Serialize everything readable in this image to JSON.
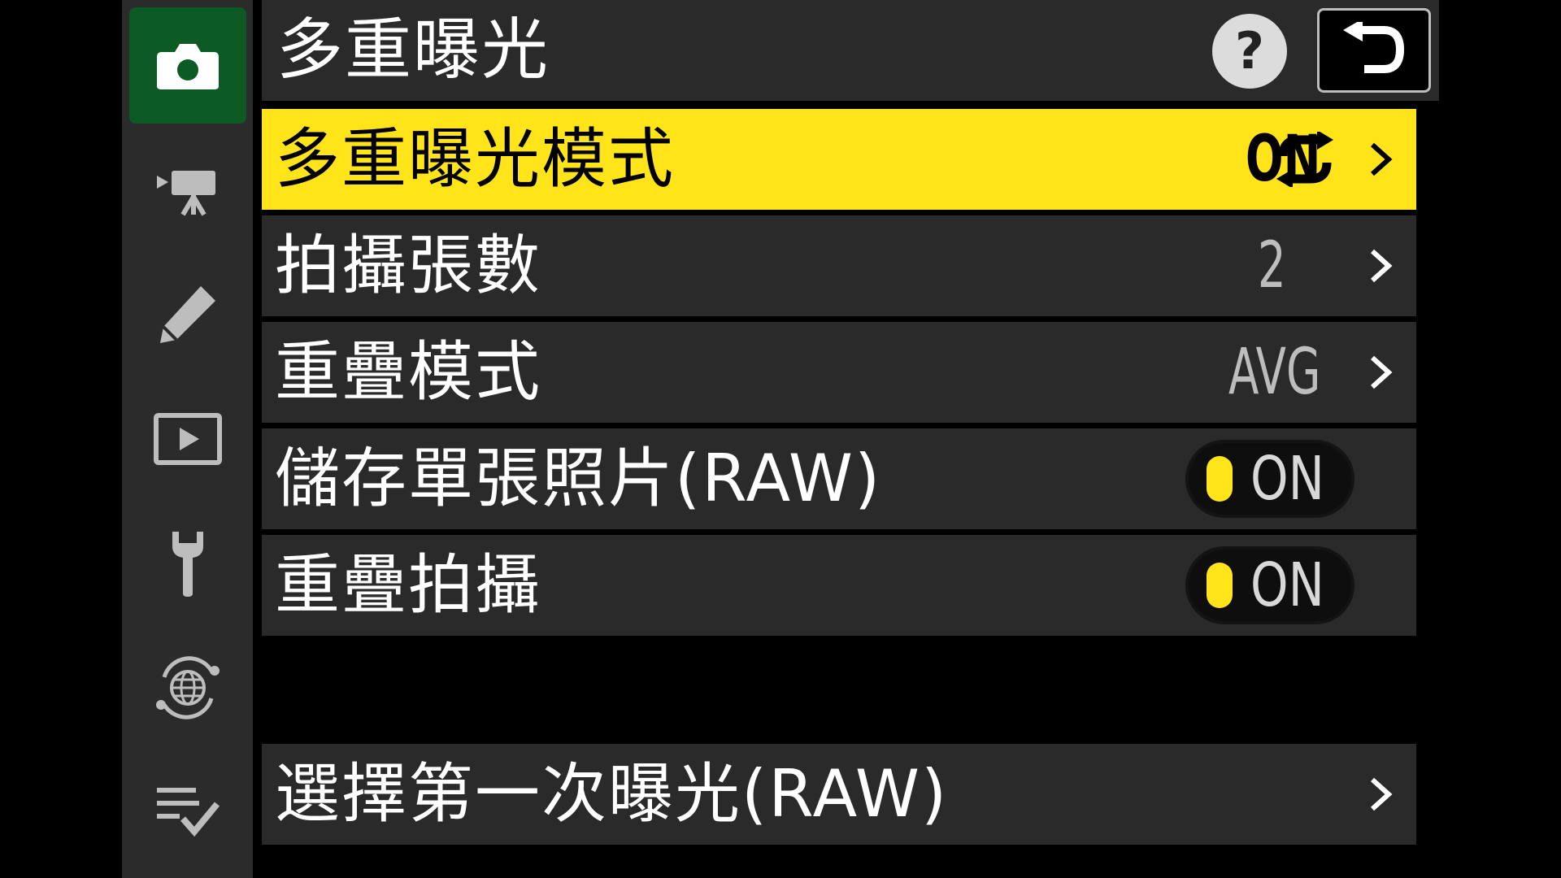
{
  "title": "多重曝光",
  "header": {
    "help_label": "?",
    "back_icon": "return-arrow-icon"
  },
  "sidebar": {
    "items": [
      {
        "name": "photo-shooting-menu",
        "icon": "camera-icon",
        "active": true
      },
      {
        "name": "video-recording-menu",
        "icon": "movie-camera-icon",
        "active": false
      },
      {
        "name": "custom-settings-menu",
        "icon": "pencil-icon",
        "active": false
      },
      {
        "name": "playback-menu",
        "icon": "play-icon",
        "active": false
      },
      {
        "name": "setup-menu",
        "icon": "wrench-icon",
        "active": false
      },
      {
        "name": "network-menu",
        "icon": "network-globe-icon",
        "active": false
      },
      {
        "name": "my-menu",
        "icon": "checklist-icon",
        "active": false
      }
    ]
  },
  "rows": [
    {
      "label": "多重曝光模式",
      "value": "ON",
      "value_icon": "repeat-icon",
      "selected": true
    },
    {
      "label": "拍攝張數",
      "value": "2"
    },
    {
      "label": "重疊模式",
      "value": "AVG"
    },
    {
      "label": "儲存單張照片(RAW)",
      "toggle": "ON"
    },
    {
      "label": "重疊拍攝",
      "toggle": "ON"
    },
    {
      "label": "選擇第一次曝光(RAW)"
    }
  ],
  "colors": {
    "highlight": "#ffe419",
    "active_tab": "#0c5a24",
    "row_bg": "#2a2a2a",
    "sidebar_bg": "#2b2b2b"
  }
}
